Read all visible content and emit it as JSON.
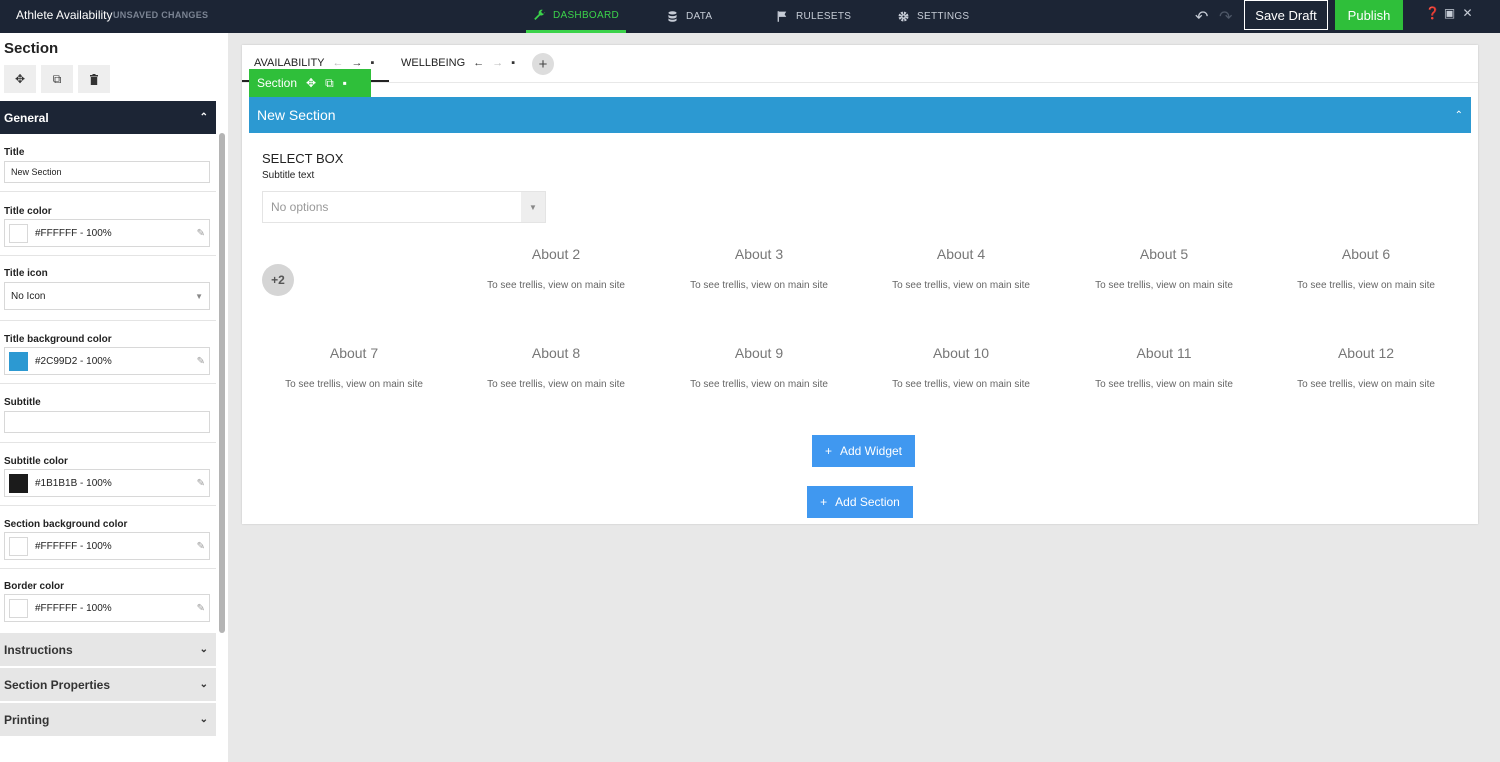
{
  "app": {
    "title": "Athlete Availability",
    "status": "UNSAVED CHANGES"
  },
  "nav": [
    {
      "label": "DASHBOARD",
      "icon": "wrench-icon",
      "active": true
    },
    {
      "label": "DATA",
      "icon": "database-icon",
      "active": false
    },
    {
      "label": "RULESETS",
      "icon": "flag-icon",
      "active": false
    },
    {
      "label": "SETTINGS",
      "icon": "gear-icon",
      "active": false
    }
  ],
  "toolbar": {
    "save_label": "Save Draft",
    "publish_label": "Publish"
  },
  "panel": {
    "title": "Section",
    "general_label": "General",
    "fields": {
      "title_label": "Title",
      "title_value": "New Section",
      "title_color_label": "Title color",
      "title_color_value": "#FFFFFF - 100%",
      "title_icon_label": "Title icon",
      "title_icon_value": "No Icon",
      "title_bg_label": "Title background color",
      "title_bg_value": "#2C99D2 - 100%",
      "subtitle_label": "Subtitle",
      "subtitle_value": "",
      "subtitle_color_label": "Subtitle color",
      "subtitle_color_value": "#1B1B1B - 100%",
      "section_bg_label": "Section background color",
      "section_bg_value": "#FFFFFF - 100%",
      "border_color_label": "Border color",
      "border_color_value": "#FFFFFF - 100%"
    },
    "collapsed_sections": [
      "Instructions",
      "Section Properties",
      "Printing"
    ]
  },
  "colors": {
    "topbar": "#1c2535",
    "accent_green": "#2fbf3a",
    "section_blue": "#2c99d2",
    "button_blue": "#4098f0",
    "subtitle_swatch": "#1b1b1b",
    "white": "#ffffff"
  },
  "canvas": {
    "tabs": [
      {
        "label": "AVAILABILITY",
        "active": true
      },
      {
        "label": "WELLBEING",
        "active": false
      }
    ],
    "chip_label": "Section",
    "section_title": "New Section",
    "select_box": {
      "title": "SELECT BOX",
      "subtitle": "Subtitle text",
      "placeholder": "No options"
    },
    "overflow_badge": "+2",
    "widgets": [
      {
        "title": "About 2",
        "note": "To see trellis, view on main site"
      },
      {
        "title": "About 3",
        "note": "To see trellis, view on main site"
      },
      {
        "title": "About 4",
        "note": "To see trellis, view on main site"
      },
      {
        "title": "About 5",
        "note": "To see trellis, view on main site"
      },
      {
        "title": "About 6",
        "note": "To see trellis, view on main site"
      },
      {
        "title": "About 7",
        "note": "To see trellis, view on main site"
      },
      {
        "title": "About 8",
        "note": "To see trellis, view on main site"
      },
      {
        "title": "About 9",
        "note": "To see trellis, view on main site"
      },
      {
        "title": "About 10",
        "note": "To see trellis, view on main site"
      },
      {
        "title": "About 11",
        "note": "To see trellis, view on main site"
      },
      {
        "title": "About 12",
        "note": "To see trellis, view on main site"
      }
    ],
    "add_widget_label": "Add Widget",
    "add_section_label": "Add Section"
  }
}
